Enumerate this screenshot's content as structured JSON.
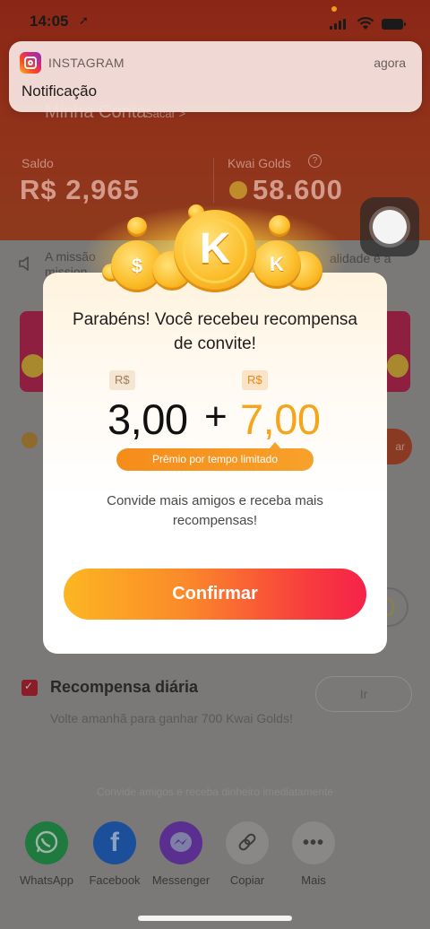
{
  "status_bar": {
    "time": "14:05",
    "location_glyph": "➚"
  },
  "notification": {
    "app": "INSTAGRAM",
    "time": "agora",
    "message": "Notificação"
  },
  "account": {
    "title": "Minha Conta",
    "withdraw_link": "Sacar >",
    "balance_label": "Saldo",
    "balance_value": "R$ 2,965",
    "golds_label": "Kwai Golds",
    "golds_help": "?",
    "golds_value": "58.600"
  },
  "notice": {
    "left_text": "A missão mission",
    "right_text": "alidade é a"
  },
  "reward_modal": {
    "coin_letter": "K",
    "coin_side_glyph": "$",
    "title": "Parabéns! Você recebeu recompensa de convite!",
    "currency": "R$",
    "base_amount": "3,00",
    "plus": "+",
    "bonus_amount": "7,00",
    "limited_label": "Prêmio por tempo limitado",
    "invite_text": "Convide mais amigos e receba mais recompensas!",
    "confirm_label": "Confirmar"
  },
  "side": {
    "right_button": "ar"
  },
  "daily_reward": {
    "title": "Recompensa diária",
    "description": "Volte amanhã para ganhar 700 Kwai Golds!",
    "button": "Ir"
  },
  "share": {
    "caption": "Convide amigos e receba dinheiro imediatamente",
    "items": [
      {
        "label": "WhatsApp",
        "icon": "whatsapp-icon",
        "color": "#1e7a3e"
      },
      {
        "label": "Facebook",
        "icon": "facebook-icon",
        "color": "#1c4f9a"
      },
      {
        "label": "Messenger",
        "icon": "messenger-icon",
        "color": "#5a2f8f"
      },
      {
        "label": "Copiar",
        "icon": "link-icon",
        "color": "#8a8787"
      },
      {
        "label": "Mais",
        "icon": "more-icon",
        "color": "#8a8787"
      }
    ]
  }
}
